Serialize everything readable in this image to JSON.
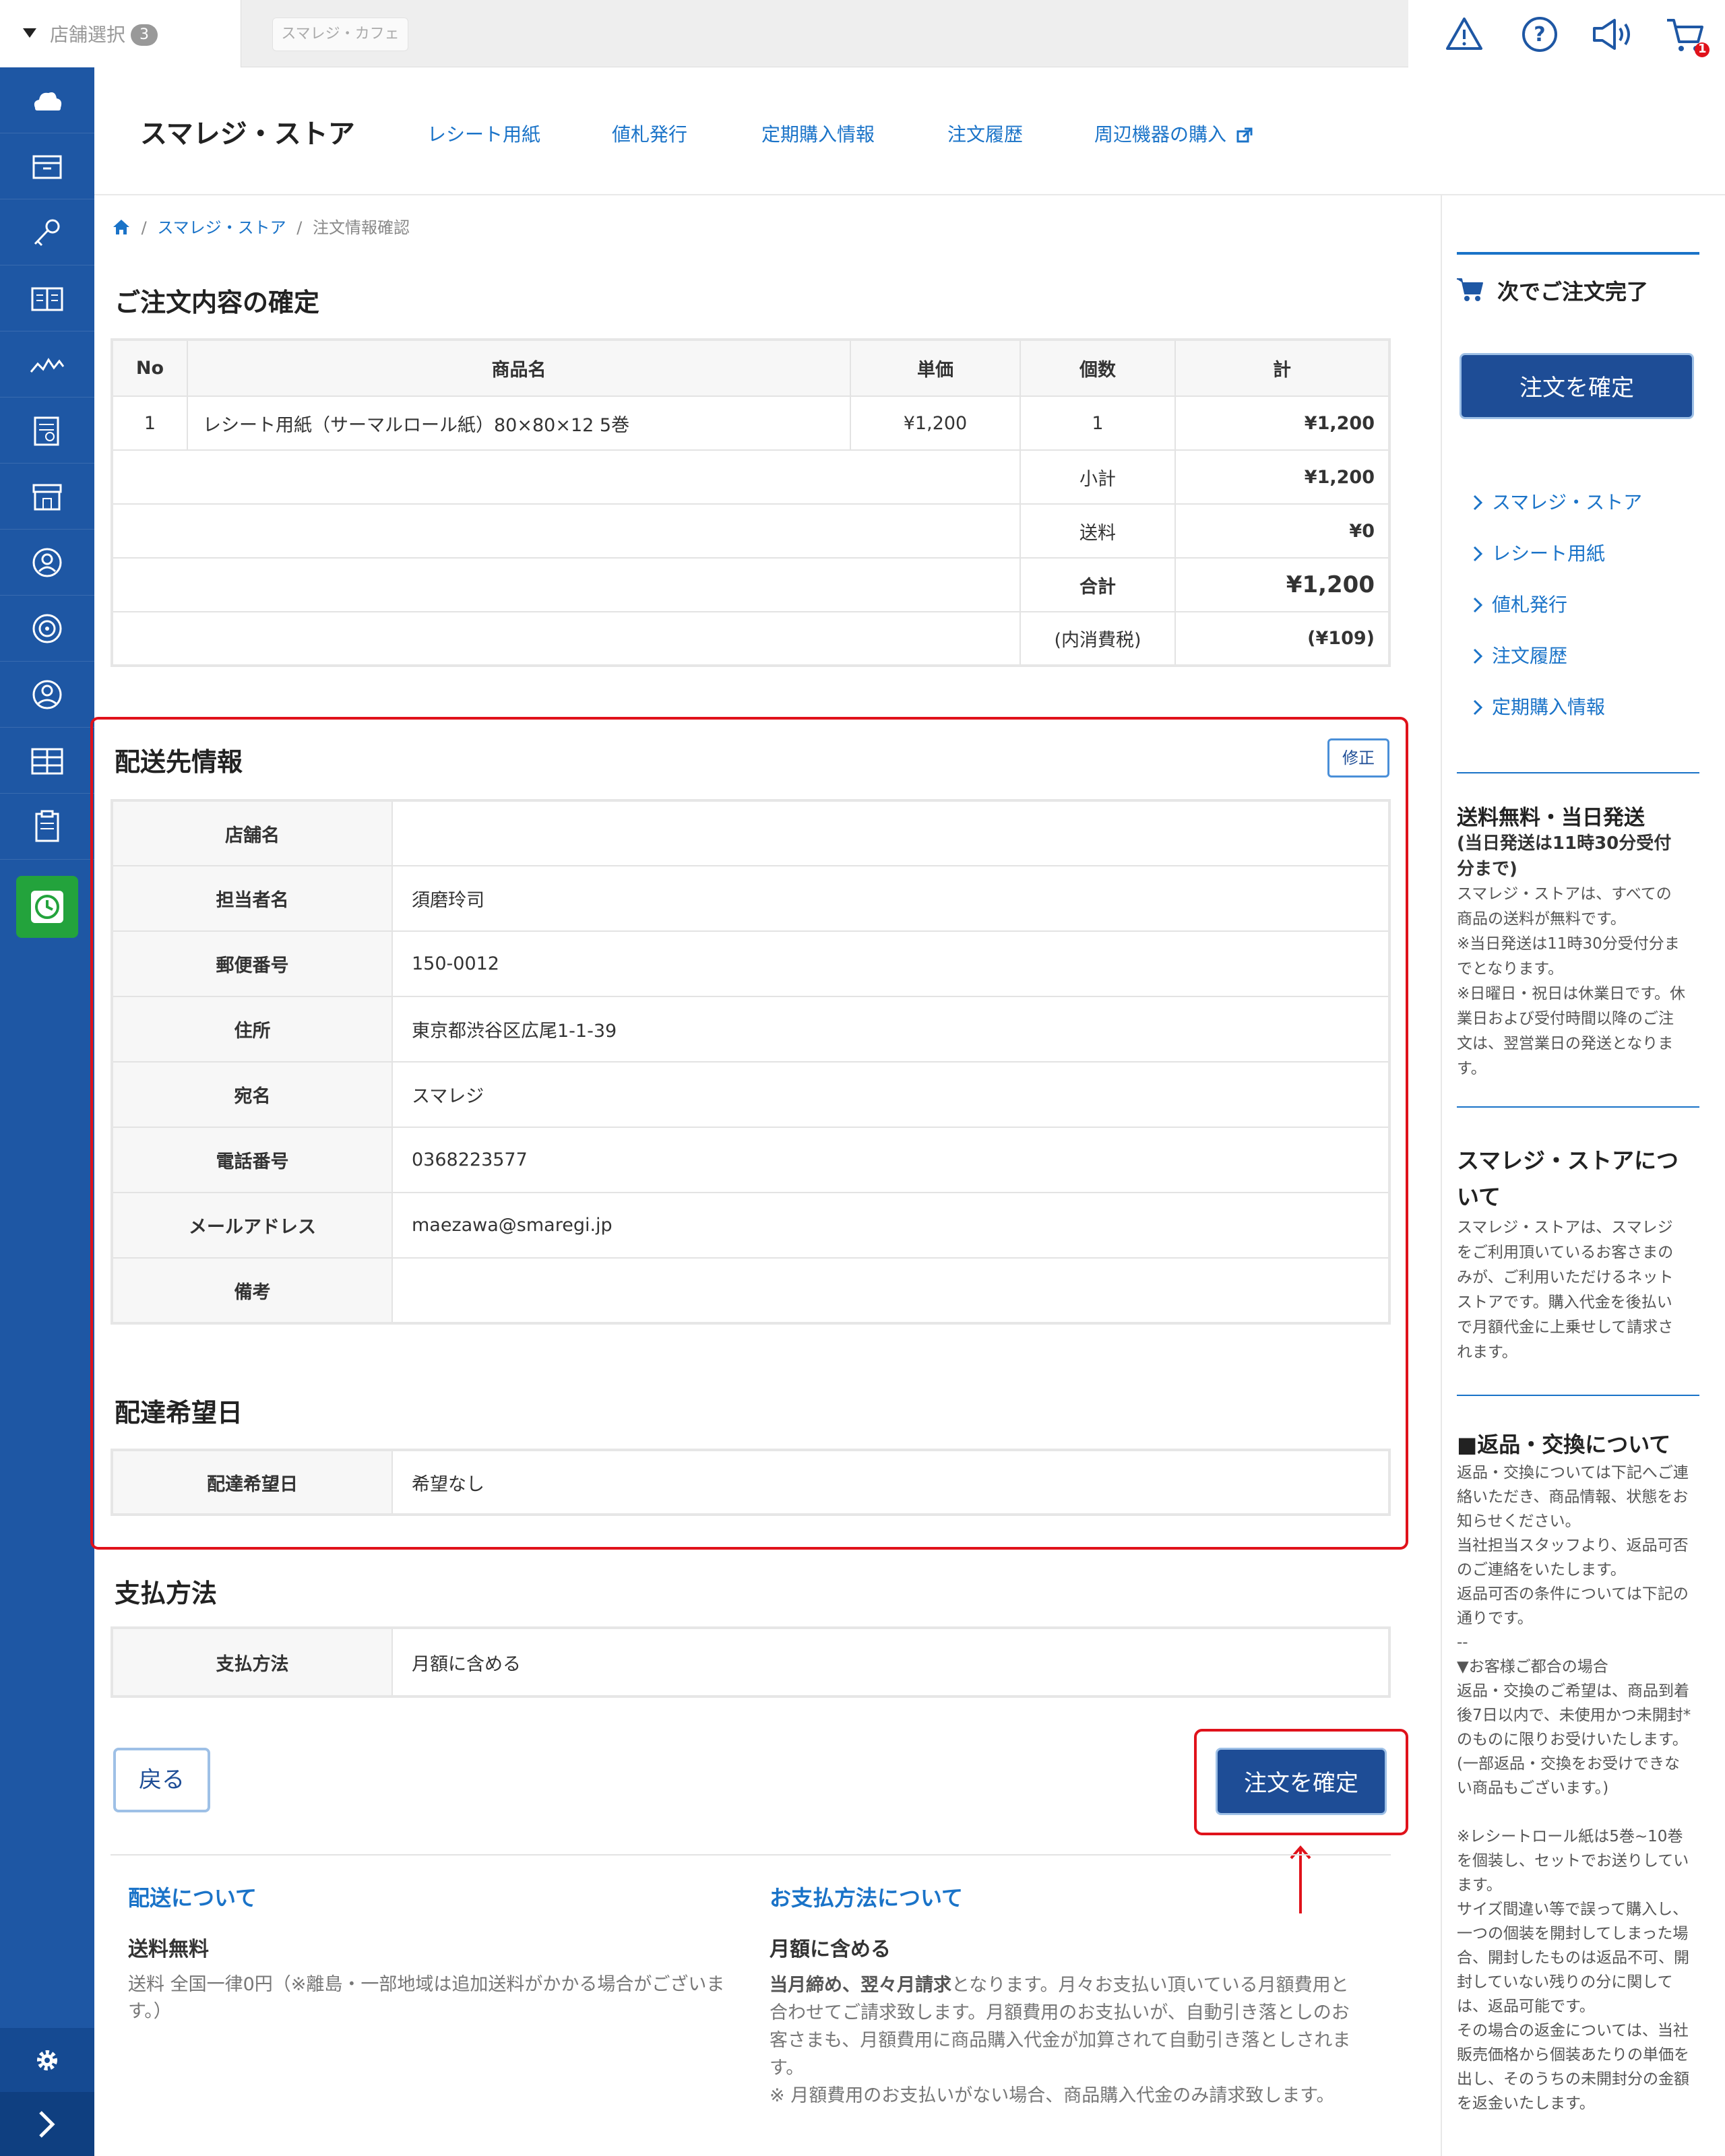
{
  "topbar": {
    "store_select_label": "店舗選択",
    "store_count": "3",
    "store_chip": "スマレジ・カフェ",
    "cart_count": "1",
    "icons": [
      "warning-icon",
      "help-icon",
      "megaphone-icon",
      "cart-icon"
    ]
  },
  "sidebar": {
    "icons": [
      "cloud-icon",
      "archive-icon",
      "key-icon",
      "book-icon",
      "chart-icon",
      "report-icon",
      "store-icon",
      "person-icon",
      "target-icon",
      "user-icon",
      "grid-icon",
      "clipboard-icon",
      "clock-icon"
    ],
    "accent": "#23a33c",
    "bg": "#1e57a4"
  },
  "header": {
    "brand": "スマレジ・ストア",
    "nav": [
      "レシート用紙",
      "値札発行",
      "定期購入情報",
      "注文履歴",
      "周辺機器の購入"
    ]
  },
  "breadcrumb": {
    "items": [
      "スマレジ・ストア",
      "注文情報確認"
    ],
    "sep": "/"
  },
  "order": {
    "title": "ご注文内容の確定",
    "headers": [
      "No",
      "商品名",
      "単価",
      "個数",
      "計"
    ],
    "rows": [
      {
        "no": "1",
        "name": "レシート用紙（サーマルロール紙）80×80×12 5巻",
        "price": "¥1,200",
        "qty": "1",
        "total": "¥1,200"
      }
    ],
    "subtotal_label": "小計",
    "subtotal": "¥1,200",
    "shipping_label": "送料",
    "shipping": "¥0",
    "total_label": "合計",
    "total": "¥1,200",
    "tax_label": "(内消費税)",
    "tax": "(¥109)"
  },
  "shipping_info": {
    "title": "配送先情報",
    "edit_label": "修正",
    "rows": [
      {
        "label": "店舗名",
        "value": ""
      },
      {
        "label": "担当者名",
        "value": "須磨玲司"
      },
      {
        "label": "郵便番号",
        "value": "150-0012"
      },
      {
        "label": "住所",
        "value": "東京都渋谷区広尾1-1-39"
      },
      {
        "label": "宛名",
        "value": "スマレジ"
      },
      {
        "label": "電話番号",
        "value": "0368223577"
      },
      {
        "label": "メールアドレス",
        "value": "maezawa@smaregi.jp"
      },
      {
        "label": "備考",
        "value": ""
      }
    ]
  },
  "delivery_date": {
    "title": "配達希望日",
    "label": "配達希望日",
    "value": "希望なし"
  },
  "payment": {
    "title": "支払方法",
    "label": "支払方法",
    "value": "月額に含める"
  },
  "actions": {
    "back": "戻る",
    "confirm": "注文を確定"
  },
  "footer": {
    "delivery_title": "配送について",
    "delivery_sub": "送料無料",
    "delivery_text": "送料 全国一律0円（※離島・一部地域は追加送料がかかる場合がございます。）",
    "payment_title": "お支払方法について",
    "payment_sub": "月額に含める",
    "payment_bold": "当月締め、翌々月請求",
    "payment_text": "となります。月々お支払い頂いている月額費用と合わせてご請求致します。月額費用のお支払いが、自動引き落としのお客さまも、月額費用に商品購入代金が加算されて自動引き落としされます。",
    "payment_note": "※ 月額費用のお支払いがない場合、商品購入代金のみ請求致します。"
  },
  "right": {
    "next_title": "次でご注文完了",
    "confirm": "注文を確定",
    "links": [
      "スマレジ・ストア",
      "レシート用紙",
      "値札発行",
      "注文履歴",
      "定期購入情報"
    ],
    "free_title": "送料無料・当日発送",
    "free_sub": "(当日発送は11時30分受付分まで)",
    "free_p1": "スマレジ・ストアは、すべての商品の送料が無料です。",
    "free_p2": "※当日発送は11時30分受付分までとなります。",
    "free_p3": "※日曜日・祝日は休業日です。休業日および受付時間以降のご注文は、翌営業日の発送となります。",
    "about_title": "スマレジ・ストアについて",
    "about_text": "スマレジ・ストアは、スマレジをご利用頂いているお客さまのみが、ご利用いただけるネットストアです。購入代金を後払いで月額代金に上乗せして請求されます。",
    "return_title": "■返品・交換について",
    "return_text": "返品・交換については下記へご連絡いただき、商品情報、状態をお知らせください。\n当社担当スタッフより、返品可否のご連絡をいたします。\n返品可否の条件については下記の通りです。\n--\n▼お客様ご都合の場合\n返品・交換のご希望は、商品到着後7日以内で、未使用かつ未開封*のものに限りお受けいたします。\n(一部返品・交換をお受けできない商品もございます。)\n\n※レシートロール紙は5巻~10巻を個装し、セットでお送りしています。\nサイズ間違い等で誤って購入し、一つの個装を開封してしまった場合、開封したものは返品不可、開封していない残りの分に関しては、返品可能です。\nその場合の返金については、当社販売価格から個装あたりの単価を出し、そのうちの未開封分の金額を返金いたします。"
  }
}
